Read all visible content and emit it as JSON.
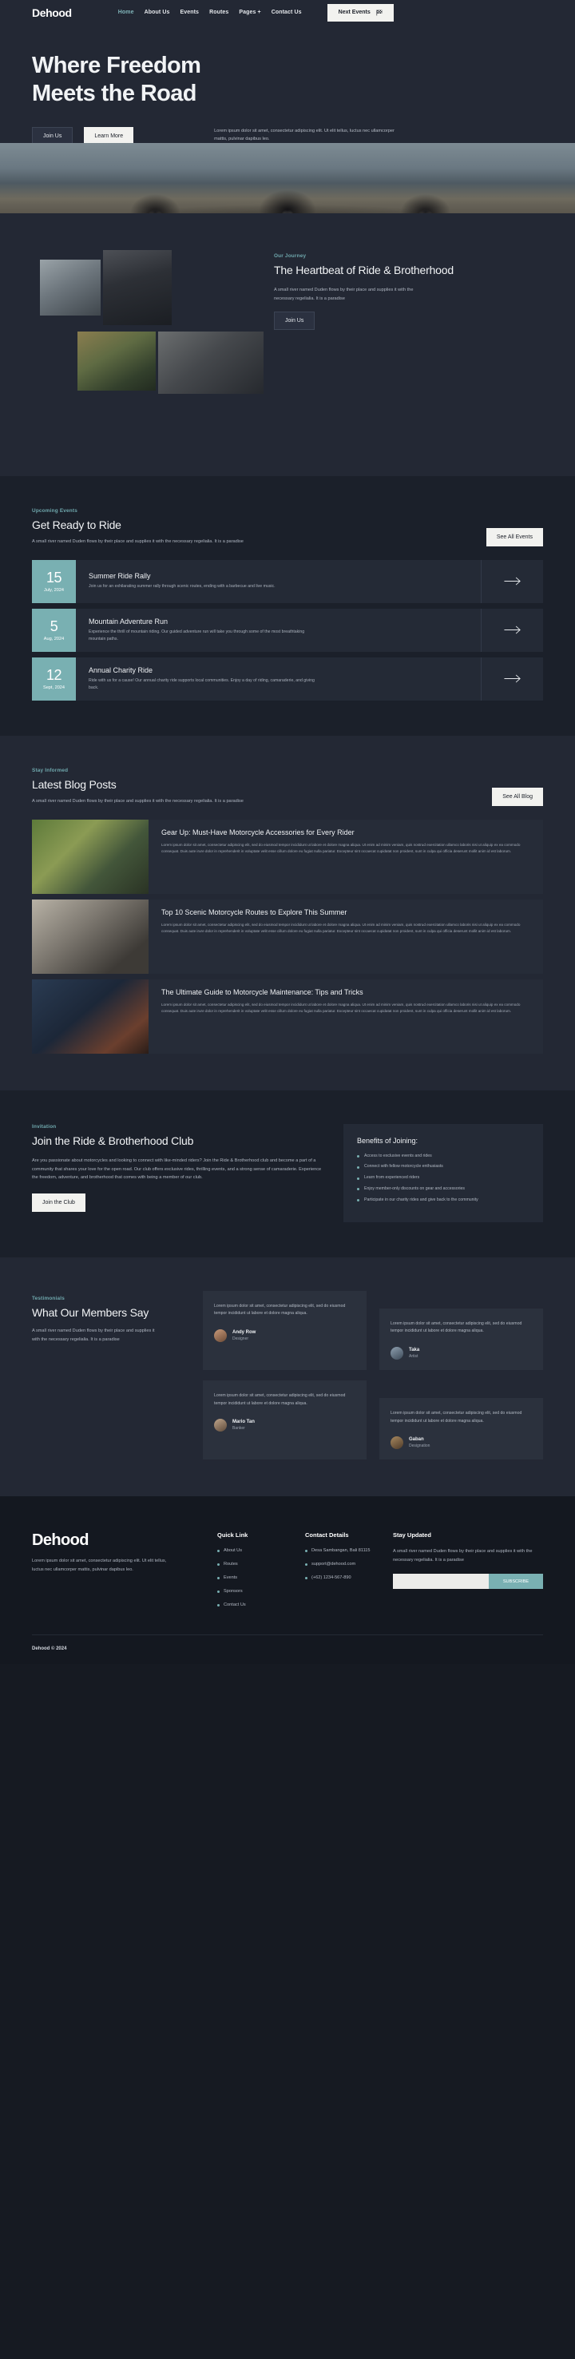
{
  "brand": "Dehood",
  "header": {
    "nav": [
      {
        "label": "Home",
        "active": true
      },
      {
        "label": "About Us",
        "active": false
      },
      {
        "label": "Events",
        "active": false
      },
      {
        "label": "Routes",
        "active": false
      },
      {
        "label": "Pages",
        "active": false,
        "has_plus": true
      },
      {
        "label": "Contact Us",
        "active": false
      }
    ],
    "cta": "Next Events"
  },
  "hero": {
    "title_line1": "Where Freedom",
    "title_line2": "Meets the Road",
    "btn_primary": "Join Us",
    "btn_secondary": "Learn More",
    "description": "Lorem ipsum dolor sit amet, consectetur adipiscing elit. Ut elit tellus, luctus nec ullamcorper mattis, pulvinar dapibus leo."
  },
  "journey": {
    "eyebrow": "Our Journey",
    "title": "The Heartbeat of Ride & Brotherhood",
    "description": "A small river named Duden flows by their place and supplies it with the necessary regelialia. It is a paradise",
    "button": "Join Us"
  },
  "events": {
    "eyebrow": "Upcoming Events",
    "title": "Get Ready to Ride",
    "description": "A small river named Duden flows by their place and supplies it with the necessary regelialia. It is a paradise",
    "see_all": "See All Events",
    "items": [
      {
        "day": "15",
        "month": "July, 2024",
        "title": "Summer Ride Rally",
        "desc": "Join us for an exhilarating summer rally through scenic routes, ending with a barbecue and live music."
      },
      {
        "day": "5",
        "month": "Aug, 2024",
        "title": "Mountain Adventure Run",
        "desc": "Experience the thrill of mountain riding. Our guided adventure run will take you through some of the most breathtaking mountain paths."
      },
      {
        "day": "12",
        "month": "Sept, 2024",
        "title": "Annual Charity Ride",
        "desc": "Ride with us for a cause! Our annual charity ride supports local communities. Enjoy a day of riding, camaraderie, and giving back."
      }
    ]
  },
  "blog": {
    "eyebrow": "Stay Informed",
    "title": "Latest Blog Posts",
    "description": "A small river named Duden flows by their place and supplies it with the necessary regelialia. It is a paradise",
    "see_all": "See All Blog",
    "posts": [
      {
        "title": "Gear Up: Must-Have Motorcycle Accessories for Every Rider",
        "text": "Lorem ipsum dolor sit amet, consectetur adipiscing elit, sed do eiusmod tempor incididunt ut labore et dolore magna aliqua. Ut enim ad minim veniam, quis nostrud exercitation ullamco laboris nisi ut aliquip ex ea commodo consequat. Duis aute irure dolor in reprehenderit in voluptate velit esse cillum dolore eu fugiat nulla pariatur. Excepteur sint occaecat cupidatat non proident, sunt in culpa qui officia deserunt mollit anim id est laborum."
      },
      {
        "title": "Top 10 Scenic Motorcycle Routes to Explore This Summer",
        "text": "Lorem ipsum dolor sit amet, consectetur adipiscing elit, sed do eiusmod tempor incididunt ut labore et dolore magna aliqua. Ut enim ad minim veniam, quis nostrud exercitation ullamco laboris nisi ut aliquip ex ea commodo consequat. Duis aute irure dolor in reprehenderit in voluptate velit esse cillum dolore eu fugiat nulla pariatur. Excepteur sint occaecat cupidatat non proident, sunt in culpa qui officia deserunt mollit anim id est laborum."
      },
      {
        "title": "The Ultimate Guide to Motorcycle Maintenance: Tips and Tricks",
        "text": "Lorem ipsum dolor sit amet, consectetur adipiscing elit, sed do eiusmod tempor incididunt ut labore et dolore magna aliqua. Ut enim ad minim veniam, quis nostrud exercitation ullamco laboris nisi ut aliquip ex ea commodo consequat. Duis aute irure dolor in reprehenderit in voluptate velit esse cillum dolore eu fugiat nulla pariatur. Excepteur sint occaecat cupidatat non proident, sunt in culpa qui officia deserunt mollit anim id est laborum."
      }
    ]
  },
  "join_club": {
    "eyebrow": "Invitation",
    "title": "Join the Ride & Brotherhood Club",
    "description": "Are you passionate about motorcycles and looking to connect with like-minded riders? Join the Ride & Brotherhood club and become a part of a community that shares your love for the open road. Our club offers exclusive rides, thrilling events, and a strong sense of camaraderie. Experience the freedom, adventure, and brotherhood that comes with being a member of our club.",
    "button": "Join the Club",
    "benefits_title": "Benefits of Joining:",
    "benefits": [
      "Access to exclusive events and rides",
      "Connect with fellow motorcycle enthusiasts",
      "Learn from experienced riders",
      "Enjoy member-only discounts on gear and accessories",
      "Participate in our charity rides and give back to the community"
    ]
  },
  "testimonials": {
    "eyebrow": "Testimonials",
    "title": "What Our Members Say",
    "description": "A small river named Duden flows by their place and supplies it with the necessary regelialia. It is a paradise",
    "items": [
      {
        "quote": "Lorem ipsum dolor sit amet, consectetur adipiscing elit, sed do eiusmod tempor incididunt ut labore et dolore magna aliqua.",
        "name": "Andy Row",
        "role": "Designer"
      },
      {
        "quote": "Lorem ipsum dolor sit amet, consectetur adipiscing elit, sed do eiusmod tempor incididunt ut labore et dolore magna aliqua.",
        "name": "Taka",
        "role": "Artist"
      },
      {
        "quote": "Lorem ipsum dolor sit amet, consectetur adipiscing elit, sed do eiusmod tempor incididunt ut labore et dolore magna aliqua.",
        "name": "Mario Tan",
        "role": "Banker"
      },
      {
        "quote": "Lorem ipsum dolor sit amet, consectetur adipiscing elit, sed do eiusmod tempor incididunt ut labore et dolore magna aliqua.",
        "name": "Gaban",
        "role": "Designation"
      }
    ]
  },
  "footer": {
    "brand": "Dehood",
    "about": "Lorem ipsum dolor sit amet, consectetur adipiscing elit. Ut elit tellus, luctus nec ullamcorper mattis, pulvinar dapibus leo.",
    "quick_link_title": "Quick Link",
    "quick_links": [
      "About Us",
      "Routes",
      "Events",
      "Sponsors",
      "Contact Us"
    ],
    "contact_title": "Contact Details",
    "contacts": [
      "Desa Sambangan, Bali 81115",
      "support@dehood.com",
      "(+62) 1234-567-890"
    ],
    "stay_title": "Stay Updated",
    "stay_text": "A small river named Duden flows by their place and supplies it with the necessary regelialia. It is a paradise",
    "email_placeholder": "",
    "email_value": "",
    "subscribe": "SUBSCRIBE",
    "copyright": "Dehood © 2024"
  },
  "colors": {
    "accent": "#79b0b2",
    "page_bg": "#1b202a",
    "panel_bg": "#232834",
    "footer_bg": "#141820",
    "light_btn": "#f2f2ef"
  }
}
